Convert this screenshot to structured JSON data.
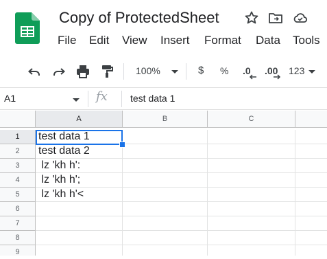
{
  "app": {
    "doc_title": "Copy of ProtectedSheet",
    "menu": [
      "File",
      "Edit",
      "View",
      "Insert",
      "Format",
      "Data",
      "Tools"
    ]
  },
  "toolbar": {
    "zoom": "100%",
    "currency": "$",
    "percent": "%",
    "decrease_decimal": ".0",
    "increase_decimal": ".00",
    "more_formats": "123"
  },
  "formula_bar": {
    "cell_ref": "A1",
    "fx": "fx",
    "value": "test data 1"
  },
  "grid": {
    "columns": [
      "A",
      "B",
      "C"
    ],
    "rows": [
      "1",
      "2",
      "3",
      "4",
      "5",
      "6",
      "7",
      "8",
      "9"
    ],
    "cells_a": [
      "test data 1",
      "test data 2",
      " lz 'kh h':",
      " lz 'kh h';",
      " lz 'kh h'<",
      "",
      "",
      "",
      ""
    ],
    "selected_cell": "A1"
  },
  "colors": {
    "accent": "#1a73e8",
    "sheets_green": "#0f9d58"
  }
}
